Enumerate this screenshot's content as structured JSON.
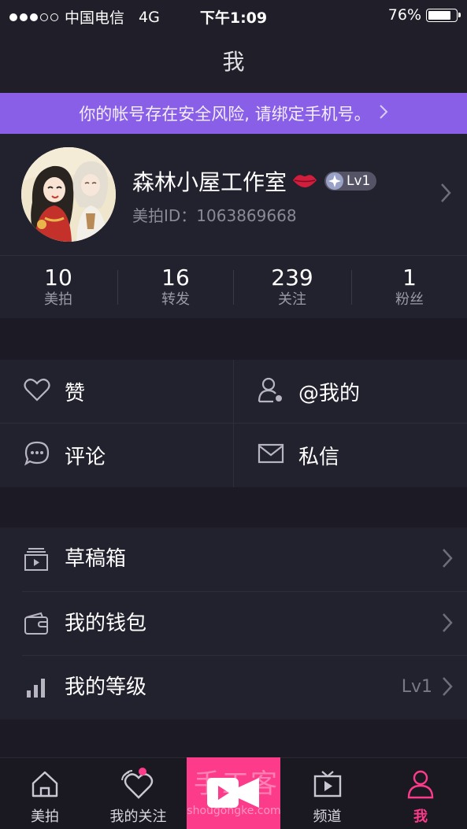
{
  "status_bar": {
    "carrier": "中国电信",
    "network": "4G",
    "time": "下午1:09",
    "battery": "76%",
    "signal_bars_filled": 3,
    "signal_bars_total": 5,
    "battery_level": 0.76
  },
  "header": {
    "title": "我"
  },
  "banner": {
    "text": "你的帐号存在安全风险, 请绑定手机号。"
  },
  "profile": {
    "name": "森林小屋工作室",
    "level_badge": "Lv1",
    "id_text": "美拍ID：1063869668"
  },
  "stats": [
    {
      "value": "10",
      "label": "美拍"
    },
    {
      "value": "16",
      "label": "转发"
    },
    {
      "value": "239",
      "label": "关注"
    },
    {
      "value": "1",
      "label": "粉丝"
    }
  ],
  "actions": [
    {
      "label": "赞",
      "icon": "heart-icon"
    },
    {
      "label": "@我的",
      "icon": "mention-user-icon"
    },
    {
      "label": "评论",
      "icon": "comment-icon"
    },
    {
      "label": "私信",
      "icon": "mail-icon"
    }
  ],
  "menu": [
    {
      "label": "草稿箱",
      "icon": "drafts-icon",
      "value": ""
    },
    {
      "label": "我的钱包",
      "icon": "wallet-icon",
      "value": ""
    },
    {
      "label": "我的等级",
      "icon": "level-bars-icon",
      "value": "Lv1"
    }
  ],
  "tabbar": {
    "tabs": [
      {
        "label": "美拍",
        "icon": "home-icon"
      },
      {
        "label": "我的关注",
        "icon": "follow-heart-icon"
      },
      {
        "label": "频道",
        "icon": "tv-icon"
      },
      {
        "label": "我",
        "icon": "person-icon"
      }
    ],
    "active_tab": "我",
    "record_icon": "video-camera-icon"
  },
  "watermark": {
    "text": "手工客",
    "subtext": "shougongke.com"
  },
  "colors": {
    "background": "#1f1e29",
    "banner": "#8a5fe8",
    "accent": "#fc3b8a",
    "panel": "#22212e"
  }
}
